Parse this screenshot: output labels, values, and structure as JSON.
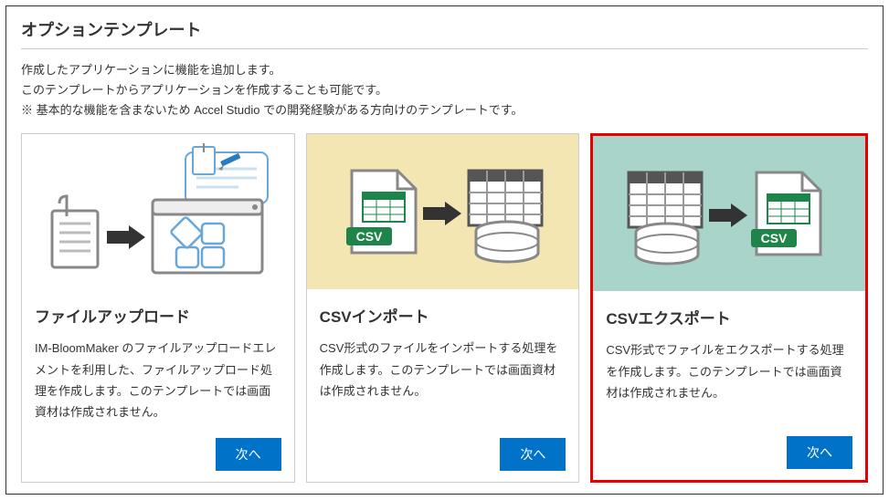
{
  "section": {
    "title": "オプションテンプレート",
    "description_line1": "作成したアプリケーションに機能を追加します。",
    "description_line2": "このテンプレートからアプリケーションを作成することも可能です。",
    "description_line3": "※ 基本的な機能を含まないため Accel Studio での開発経験がある方向けのテンプレートです。"
  },
  "cards": [
    {
      "title": "ファイルアップロード",
      "description": "IM-BloomMaker のファイルアップロードエレメントを利用した、ファイルアップロード処理を作成します。このテンプレートでは画面資材は作成されません。",
      "button_label": "次へ"
    },
    {
      "title": "CSVインポート",
      "description": "CSV形式のファイルをインポートする処理を作成します。このテンプレートでは画面資材は作成されません。",
      "button_label": "次へ"
    },
    {
      "title": "CSVエクスポート",
      "description": "CSV形式でファイルをエクスポートする処理を作成します。このテンプレートでは画面資材は作成されません。",
      "button_label": "次へ"
    }
  ]
}
